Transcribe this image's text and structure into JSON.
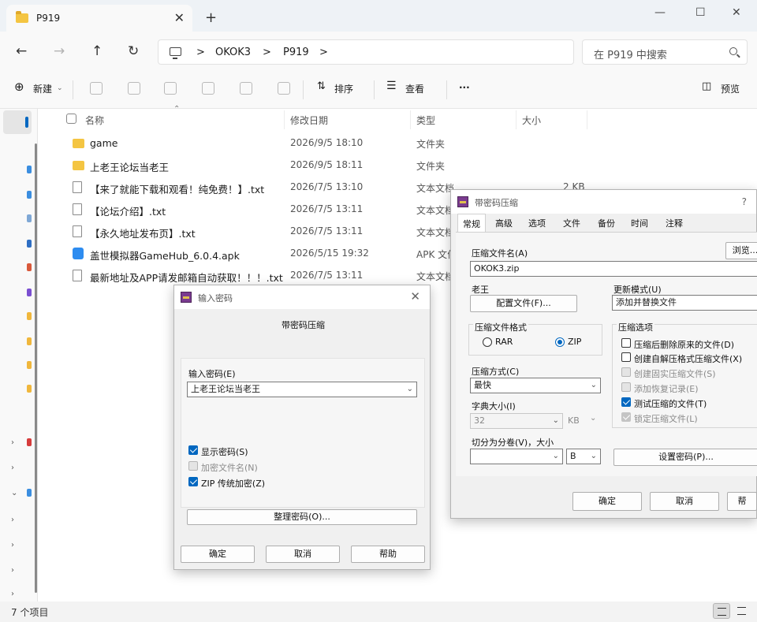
{
  "window": {
    "tab_title": "P919",
    "tab_close": "✕",
    "new_tab": "+",
    "minimize": "—",
    "maximize": "☐",
    "close": "✕"
  },
  "address": {
    "back": "←",
    "forward": "→",
    "up": "↑",
    "refresh": "↻",
    "chev": ">",
    "crumbs": [
      "OKOK3",
      "P919"
    ],
    "search_placeholder": "在 P919 中搜索"
  },
  "toolbar": {
    "new_label": "新建",
    "sort_label": "排序",
    "view_label": "查看",
    "more": "···",
    "preview_label": "预览"
  },
  "columns": {
    "name": "名称",
    "modified": "修改日期",
    "type": "类型",
    "size": "大小"
  },
  "files": [
    {
      "name": "game",
      "date": "2026/9/5 18:10",
      "type": "文件夹",
      "size": "",
      "kind": "folder"
    },
    {
      "name": "上老王论坛当老王",
      "date": "2026/9/5 18:11",
      "type": "文件夹",
      "size": "",
      "kind": "folder"
    },
    {
      "name": "【来了就能下载和观看！纯免费！】.txt",
      "date": "2026/7/5 13:10",
      "type": "文本文档",
      "size": "2 KB",
      "kind": "txt"
    },
    {
      "name": "【论坛介绍】.txt",
      "date": "2026/7/5 13:11",
      "type": "文本文档",
      "size": "",
      "kind": "txt"
    },
    {
      "name": "【永久地址发布页】.txt",
      "date": "2026/7/5 13:11",
      "type": "文本文档",
      "size": "",
      "kind": "txt"
    },
    {
      "name": "盖世模拟器GameHub_6.0.4.apk",
      "date": "2026/5/15 19:32",
      "type": "APK 文件",
      "size": "",
      "kind": "apk"
    },
    {
      "name": "最新地址及APP请发邮箱自动获取！！！.txt",
      "date": "2026/7/5 13:11",
      "type": "文本文档",
      "size": "",
      "kind": "txt"
    }
  ],
  "status": {
    "count": "7 个项目"
  },
  "pwd_dialog": {
    "title": "输入密码",
    "heading": "带密码压缩",
    "enter_label": "输入密码(E)",
    "password_value": "上老王论坛当老王",
    "show_password": "显示密码(S)",
    "encrypt_names": "加密文件名(N)",
    "zip_legacy": "ZIP 传统加密(Z)",
    "organize": "整理密码(O)...",
    "ok": "确定",
    "cancel": "取消",
    "help": "帮助",
    "close": "✕"
  },
  "archive_dialog": {
    "title": "带密码压缩",
    "help_q": "?",
    "tabs": [
      "常规",
      "高级",
      "选项",
      "文件",
      "备份",
      "时间",
      "注释"
    ],
    "archive_name_label": "压缩文件名(A)",
    "archive_name": "OKOK3.zip",
    "browse": "浏览...",
    "profile_label": "老王",
    "profiles_btn": "配置文件(F)...",
    "update_mode_label": "更新模式(U)",
    "update_mode": "添加并替换文件",
    "format_group": "压缩文件格式",
    "rar": "RAR",
    "zip": "ZIP",
    "method_label": "压缩方式(C)",
    "method": "最快",
    "dict_label": "字典大小(I)",
    "dict_value": "32",
    "dict_unit": "KB",
    "split_label": "切分为分卷(V)，大小",
    "split_unit": "B",
    "options_group": "压缩选项",
    "opt_delete": "压缩后删除原来的文件(D)",
    "opt_sfx": "创建自解压格式压缩文件(X)",
    "opt_solid": "创建固实压缩文件(S)",
    "opt_recovery": "添加恢复记录(E)",
    "opt_test": "测试压缩的文件(T)",
    "opt_lock": "锁定压缩文件(L)",
    "set_password": "设置密码(P)...",
    "ok": "确定",
    "cancel": "取消",
    "help": "帮"
  }
}
